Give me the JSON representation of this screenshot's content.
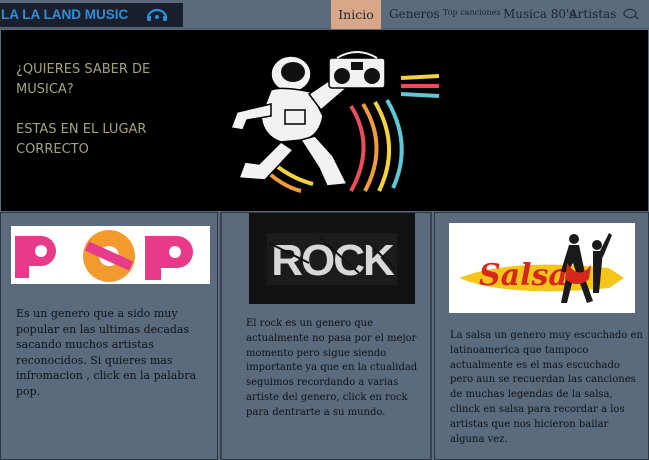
{
  "brand": {
    "name": "LA LA LAND MUSIC",
    "logo_icon": "headphones-icon"
  },
  "nav": {
    "items": [
      {
        "label": "Inicio",
        "active": true
      },
      {
        "label": "Generos"
      },
      {
        "label": "Top canciones"
      },
      {
        "label": "Musica 80's"
      },
      {
        "label": "Artistas"
      }
    ],
    "search_icon": "search-icon",
    "active_color": "#d9a788"
  },
  "hero": {
    "question": "¿QUIERES SABER DE MUSICA?",
    "answer": "ESTAS EN EL LUGAR CORRECTO",
    "image_icon": "astronaut-boombox-image"
  },
  "cards": [
    {
      "image_label": "POP",
      "text": "Es un genero que a sido muy popular en las ultimas decadas sacando muchos artistas reconocidos. Si quieres mas infromacion , click en la palabra pop."
    },
    {
      "image_label": "ROCK",
      "text": "El rock es un genero que actualmente no pasa por el mejor momento pero sigue siendo importante ya que en la ctualidad seguimos recordando a varias artiste del genero, click en rock para dentrarte a su mundo."
    },
    {
      "image_label": "Salsa",
      "text": "La salsa un genero muy escuchado en latinoamerica que tampoco actualmente es el mas escuchado pero aun se recuerdan las canciones de muchas legendas de la salsa, clinck en salsa para recordar a los artistas que nos hicieron bailar alguna vez."
    }
  ],
  "colors": {
    "background": "#5b6b7e",
    "brand_text": "#2f8fd6",
    "hero_text": "#a5a37c"
  }
}
